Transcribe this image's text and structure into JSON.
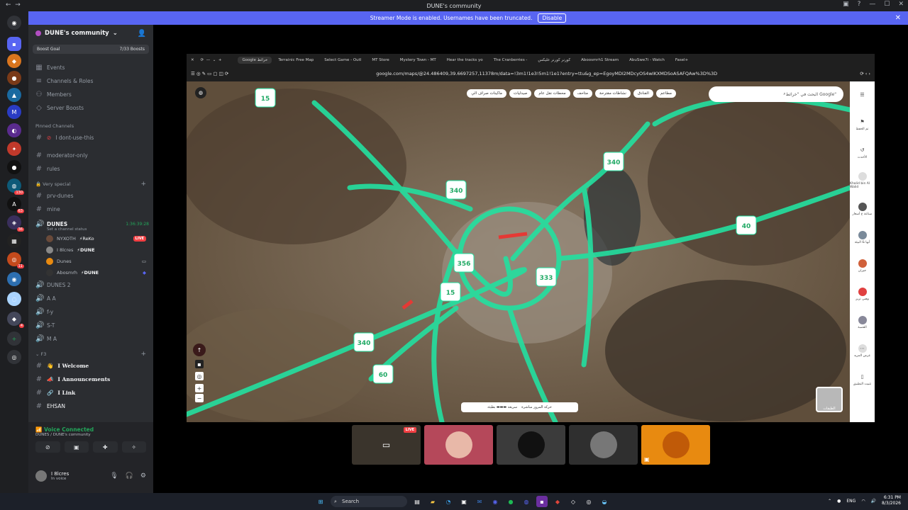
{
  "window": {
    "title": "DUNE's community"
  },
  "streamer": {
    "text": "Streamer Mode is enabled. Usernames have been truncated.",
    "button": "Disable"
  },
  "server": {
    "name": "DUNE's community",
    "boost_label": "Boost Goal",
    "boost_count": "7/33 Boosts"
  },
  "top_items": [
    "Events",
    "Channels & Roles",
    "Members",
    "Server Boosts"
  ],
  "pinned": {
    "header": "Pinned Channels",
    "channel": "I dont-use-this"
  },
  "channels_a": [
    "moderator-only",
    "rules"
  ],
  "cat_special": "Very special",
  "channels_b": [
    "prv-dunes",
    "mine"
  ],
  "voice_main": {
    "name": "DUNES",
    "time": "1:36:39:28",
    "status": "Set a channel status"
  },
  "voice_users": [
    {
      "name": "NYXOTH",
      "tag": "⚡ReKo",
      "live": "LIVE"
    },
    {
      "name": "I 8lcres",
      "tag": "⚡DUNE",
      "live": ""
    },
    {
      "name": "Dunes",
      "tag": "",
      "live": ""
    },
    {
      "name": "Abosmrh",
      "tag": "⚡DUNE",
      "live": ""
    }
  ],
  "voice_channels": [
    "DUNES 2",
    "A A",
    "f-y",
    "S-T",
    "M A"
  ],
  "cat_f3": "F3",
  "channels_c": [
    "I Welcome",
    "I Announcements",
    "I Link",
    "EHSAN"
  ],
  "voicebar": {
    "title": "Voice Connected",
    "sub": "DUNES / DUNE's community"
  },
  "userpanel": {
    "name": "I 8lcres",
    "status": "In voice"
  },
  "browser": {
    "tabs": [
      "Google خرائط",
      "Terrainic Free Map",
      "Select Game - Outl",
      "MT Store",
      "Mystery Town - MT",
      "Hear the tracks yo",
      "The Cranberries - ",
      "كورنر كورنر عليكس",
      "Aboosmrh1 Stream",
      "AbuSwe7i - Watch",
      "Fasel+"
    ],
    "url": "google.com/maps/@24.486409,39.6697257,11378m/data=!3m1!1e3!5m1!1e1?entry=ttu&g_ep=EgoyMDI2MDcyOS4wIKXMDSoASAFQAw%3D%3D"
  },
  "map": {
    "search_placeholder": "البحث في \"خرائط Google\"",
    "chips": [
      "مطاعم",
      "الفنادق",
      "نشاطات مقترحة",
      "متاحف",
      "محطات نقل عام",
      "صيدليات",
      "ماكينات صراف الي"
    ],
    "traffic_label": "حركة المرور مباشرة",
    "traffic_scale": "سريعة ▬▬▬ بطيئة",
    "layers_label": "الطبقات",
    "route_labels": [
      "15",
      "340",
      "340",
      "40",
      "356",
      "333",
      "15",
      "340",
      "60"
    ],
    "panel_items": [
      "تم الحفظ",
      "الأحدث",
      "Khalid bin Al Walid",
      "صناعة ع أسعار",
      "أبها & البيئة",
      "جيزان",
      "وهبي تريز",
      "القصبة",
      "عرض المزيد",
      "تثبيت التطبيق"
    ]
  },
  "tiles": [
    {
      "live": "LIVE",
      "color": "#3a342c"
    },
    {
      "live": "",
      "color": "#b5485a"
    },
    {
      "live": "",
      "color": "#3b3b3b"
    },
    {
      "live": "",
      "color": "#2f2f2f"
    },
    {
      "live": "",
      "color": "#e88a10"
    }
  ],
  "taskbar": {
    "search": "Search",
    "lang": "ENG",
    "time": "6:31 PM",
    "date": "8/3/2026"
  }
}
